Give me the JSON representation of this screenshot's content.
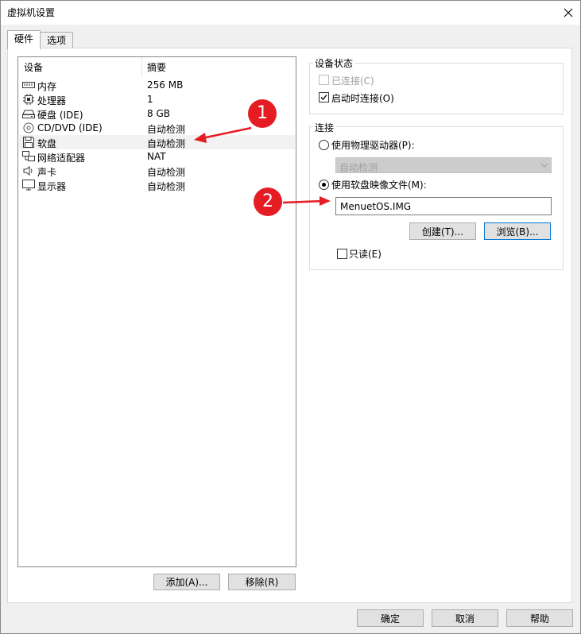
{
  "window": {
    "title": "虚拟机设置",
    "close_glyph": "✕"
  },
  "tabs": [
    {
      "label": "硬件",
      "active": true
    },
    {
      "label": "选项",
      "active": false
    }
  ],
  "device_list": {
    "header_device": "设备",
    "header_summary": "摘要",
    "rows": [
      {
        "name": "内存",
        "summary": "256 MB",
        "icon": "memory-icon"
      },
      {
        "name": "处理器",
        "summary": "1",
        "icon": "processor-icon"
      },
      {
        "name": "硬盘 (IDE)",
        "summary": "8 GB",
        "icon": "hard-disk-icon"
      },
      {
        "name": "CD/DVD (IDE)",
        "summary": "自动检测",
        "icon": "cd-dvd-icon"
      },
      {
        "name": "软盘",
        "summary": "自动检测",
        "icon": "floppy-icon",
        "selected": true
      },
      {
        "name": "网络适配器",
        "summary": "NAT",
        "icon": "network-adapter-icon"
      },
      {
        "name": "声卡",
        "summary": "自动检测",
        "icon": "sound-card-icon"
      },
      {
        "name": "显示器",
        "summary": "自动检测",
        "icon": "display-icon"
      }
    ]
  },
  "buttons": {
    "add": "添加(A)...",
    "remove": "移除(R)",
    "ok": "确定",
    "cancel": "取消",
    "help": "帮助"
  },
  "device_status": {
    "title": "设备状态",
    "connected_label": "已连接(C)",
    "connected_checked": false,
    "connected_disabled": true,
    "connect_on_power_label": "启动时连接(O)",
    "connect_on_power_checked": true
  },
  "connection": {
    "title": "连接",
    "physical_drive_label": "使用物理驱动器(P):",
    "physical_drive_selected": false,
    "physical_drive_value": "自动检测",
    "image_file_label": "使用软盘映像文件(M):",
    "image_file_selected": true,
    "image_file_value": "MenuetOS.IMG",
    "create_button": "创建(T)...",
    "browse_button": "浏览(B)...",
    "read_only_label": "只读(E)",
    "read_only_checked": false
  },
  "annotations": [
    {
      "label": "1"
    },
    {
      "label": "2"
    }
  ],
  "colors": {
    "annotation": "#e51c23",
    "focus_border": "#0078d7",
    "selected_row": "#f2f2f2"
  }
}
